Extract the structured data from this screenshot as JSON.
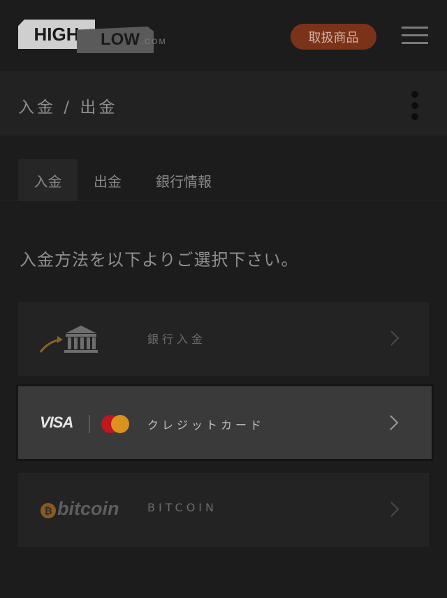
{
  "header": {
    "logo_high": "HIGH",
    "logo_low": "LOW",
    "logo_com": ".COM",
    "products_button": "取扱商品",
    "menu_icon": "hamburger-menu-icon",
    "accent_color": "#7a3219"
  },
  "titlebar": {
    "breadcrumb": "入金 / 出金",
    "more_icon": "kebab-menu-icon"
  },
  "tabs": [
    {
      "label": "入金",
      "active": true
    },
    {
      "label": "出金",
      "active": false
    },
    {
      "label": "銀行情報",
      "active": false
    }
  ],
  "instruction": "入金方法を以下よりご選択下さい。",
  "methods": [
    {
      "label": "銀行入金",
      "icon": "bank-icon",
      "highlighted": false
    },
    {
      "label": "クレジットカード",
      "icon": "visa-mastercard-logo",
      "visa_text": "VISA",
      "highlighted": true
    },
    {
      "label": "BITCOIN",
      "icon": "bitcoin-logo",
      "bitcoin_symbol": "₿",
      "bitcoin_text": "bitcoin",
      "highlighted": false
    }
  ]
}
